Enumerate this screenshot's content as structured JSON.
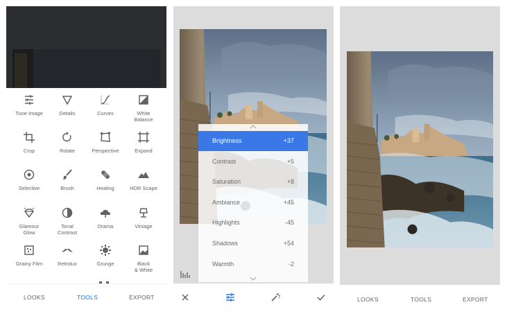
{
  "tools_screen": {
    "tools": [
      {
        "label": "Tune Image",
        "icon": "sliders-icon"
      },
      {
        "label": "Details",
        "icon": "triangle-icon"
      },
      {
        "label": "Curves",
        "icon": "curves-icon"
      },
      {
        "label": "White\nBalance",
        "icon": "white-balance-icon"
      },
      {
        "label": "Crop",
        "icon": "crop-icon"
      },
      {
        "label": "Rotate",
        "icon": "rotate-icon"
      },
      {
        "label": "Perspective",
        "icon": "perspective-icon"
      },
      {
        "label": "Expand",
        "icon": "expand-icon"
      },
      {
        "label": "Selective",
        "icon": "target-icon"
      },
      {
        "label": "Brush",
        "icon": "brush-icon"
      },
      {
        "label": "Healing",
        "icon": "bandage-icon"
      },
      {
        "label": "HDR Scape",
        "icon": "mountain-icon"
      },
      {
        "label": "Glamour\nGlow",
        "icon": "diamond-icon"
      },
      {
        "label": "Tonal\nContrast",
        "icon": "contrast-icon"
      },
      {
        "label": "Drama",
        "icon": "cloud-icon"
      },
      {
        "label": "Vintage",
        "icon": "lamp-icon"
      },
      {
        "label": "Grainy Film",
        "icon": "film-grain-icon"
      },
      {
        "label": "Retrolux",
        "icon": "mustache-icon"
      },
      {
        "label": "Grunge",
        "icon": "grunge-icon"
      },
      {
        "label": "Black\n& White",
        "icon": "black-white-icon"
      }
    ],
    "tabs": {
      "looks": "LOOKS",
      "tools": "TOOLS",
      "export": "EXPORT"
    },
    "active_tab": "TOOLS",
    "accent": "#1a73e8"
  },
  "adjust_screen": {
    "adjustments": [
      {
        "name": "Brightness",
        "value": "+37",
        "selected": true
      },
      {
        "name": "Contrast",
        "value": "+5",
        "selected": false
      },
      {
        "name": "Saturation",
        "value": "+8",
        "selected": false
      },
      {
        "name": "Ambiance",
        "value": "+45",
        "selected": false
      },
      {
        "name": "Highlights",
        "value": "-45",
        "selected": false
      },
      {
        "name": "Shadows",
        "value": "+54",
        "selected": false
      },
      {
        "name": "Warmth",
        "value": "-2",
        "selected": false
      }
    ],
    "highlight_color": "#3b78e7",
    "bottom_icons": [
      "close-icon",
      "adjust-sliders-icon",
      "magic-wand-icon",
      "checkmark-icon"
    ]
  },
  "result_screen": {
    "tabs": {
      "looks": "LOOKS",
      "tools": "TOOLS",
      "export": "EXPORT"
    }
  }
}
